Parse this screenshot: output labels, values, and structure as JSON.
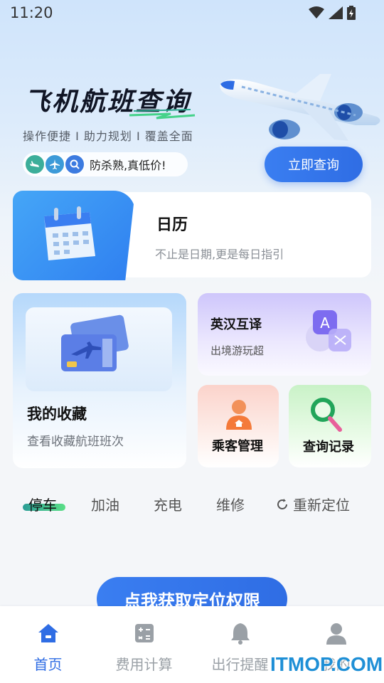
{
  "status_bar": {
    "time": "11:20"
  },
  "hero": {
    "title": "飞机航班查询",
    "subtitle": "操作便捷 I 助力规划 I 覆盖全面",
    "tag_text": "防杀熟,真低价!",
    "query_button": "立即查询"
  },
  "calendar": {
    "title": "日历",
    "desc": "不止是日期,更是每日指引"
  },
  "favorites": {
    "title": "我的收藏",
    "desc": "查看收藏航班班次"
  },
  "translate": {
    "title": "英汉互译",
    "desc": "出境游玩超"
  },
  "passenger": {
    "title": "乘客管理"
  },
  "history": {
    "title": "查询记录"
  },
  "nearby": {
    "tabs": [
      "停车",
      "加油",
      "充电",
      "维修"
    ],
    "active_tab": "停车",
    "relocate": "重新定位"
  },
  "location_button": "点我获取定位权限",
  "bottom_nav": {
    "items": [
      "首页",
      "费用计算",
      "出行提醒",
      "我的"
    ],
    "active": "首页"
  },
  "watermark": "ITMOP.COM",
  "colors": {
    "primary": "#2f6de4",
    "accent_green": "#5adf86"
  }
}
